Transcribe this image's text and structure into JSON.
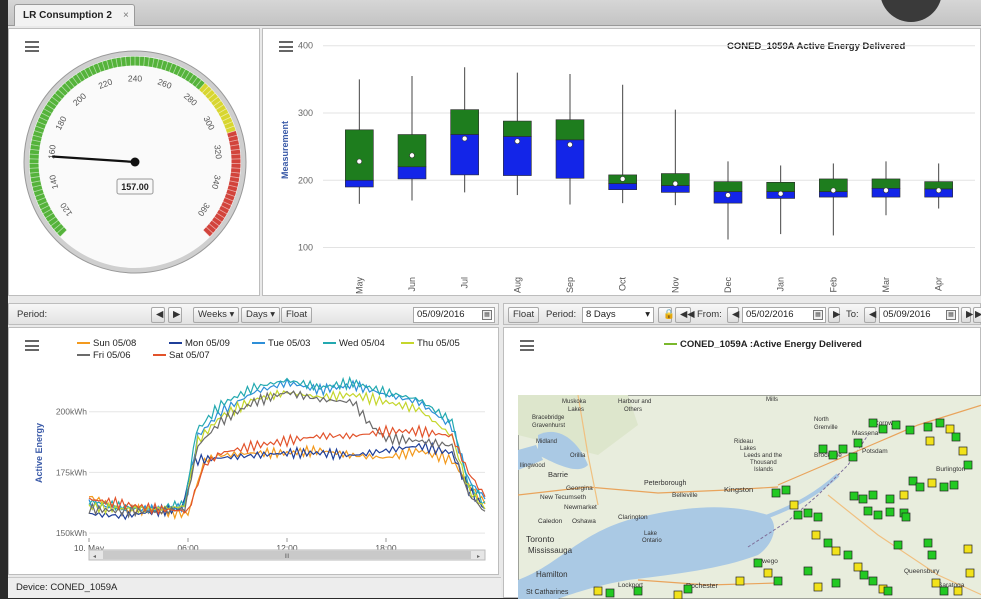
{
  "tab": {
    "label": "LR Consumption 2",
    "close": "×"
  },
  "gauge": {
    "value": 157.0,
    "value_label": "157.00",
    "ticks": [
      "120",
      "140",
      "160",
      "180",
      "200",
      "220",
      "240",
      "260",
      "280",
      "300",
      "320",
      "340",
      "360"
    ],
    "min": 110,
    "max": 370,
    "bands": [
      {
        "from": 110,
        "to": 280,
        "color": "#55b33b"
      },
      {
        "from": 280,
        "to": 310,
        "color": "#d8d630"
      },
      {
        "from": 310,
        "to": 370,
        "color": "#d2443c"
      }
    ]
  },
  "boxplot": {
    "title": "CONED_1059A Active Energy Delivered",
    "ylabel": "Measurement",
    "y_ticks": [
      "400",
      "300",
      "200",
      "100"
    ]
  },
  "line_toolbar": {
    "period_label": "Period:",
    "weeks": "Weeks ▾",
    "days": "Days ▾",
    "float": "Float",
    "date": "05/09/2016"
  },
  "line_chart": {
    "ylabel": "Active Energy",
    "y_ticks": [
      "200kWh",
      "175kWh",
      "150kWh"
    ],
    "x_ticks": [
      "10. May",
      "06:00",
      "12:00",
      "18:00"
    ],
    "scroll_grip": "III"
  },
  "map_toolbar": {
    "float": "Float",
    "period_label": "Period:",
    "period_value": "8 Days",
    "from_label": "From:",
    "from_value": "05/02/2016",
    "to_label": "To:",
    "to_value": "05/09/2016"
  },
  "map": {
    "legend": "CONED_1059A :Active Energy Delivered",
    "legend_color": "#7ab82c",
    "labels": {
      "muskoka": "Muskoka",
      "lakes": "Lakes",
      "bracebridge": "Bracebridge",
      "gravenhurst": "Gravenhurst",
      "harbour": "Harbour and",
      "others": "Others",
      "midland": "Midland",
      "orillia": "Orillia",
      "barrie": "Barrie",
      "georgina": "Georgina",
      "newtecumseth": "New Tecumseth",
      "newmarket": "Newmarket",
      "peterborough": "Peterborough",
      "belleville": "Belleville",
      "kingston": "Kingston",
      "clarington": "Clarington",
      "caledon": "Caledon",
      "oshawa": "Oshawa",
      "toronto": "Toronto",
      "mississauga": "Mississauga",
      "hamilton": "Hamilton",
      "stcatharines": "St Catharines",
      "lakeontario": "Lake",
      "lakeontario2": "Ontario",
      "lockport": "Lockport",
      "rochester": "Rochester",
      "rideau": "Rideau",
      "rideau2": "Lakes",
      "leeds": "Leeds and the",
      "thousand": "Thousand",
      "islands": "Islands",
      "brockville": "Brockville",
      "massena": "Massena",
      "potsdam": "Potsdam",
      "cornwall": "Cornwall",
      "burlington": "Burlington",
      "queensbury": "Queensbury",
      "saratoga": "Saratoga",
      "north": "North",
      "grenville": "Grenville",
      "mills": "Mills",
      "lingwood": "llingwood",
      "oswego": "Oswego"
    }
  },
  "status": {
    "text": "Device: CONED_1059A"
  },
  "chart_data": [
    {
      "type": "gauge",
      "value": 157.0,
      "min": 110,
      "max": 370
    },
    {
      "type": "boxplot",
      "title": "CONED_1059A Active Energy Delivered",
      "ylabel": "Measurement",
      "xlabel": "",
      "ylim": [
        80,
        410
      ],
      "categories": [
        "May",
        "Jun",
        "Jul",
        "Aug",
        "Sep",
        "Oct",
        "Nov",
        "Dec",
        "Jan",
        "Feb",
        "Mar",
        "Apr"
      ],
      "boxes": [
        {
          "min": 165,
          "q1": 190,
          "median": 200,
          "q3": 275,
          "max": 350,
          "mean": 228
        },
        {
          "min": 170,
          "q1": 202,
          "median": 220,
          "q3": 268,
          "max": 355,
          "mean": 237
        },
        {
          "min": 182,
          "q1": 208,
          "median": 268,
          "q3": 305,
          "max": 368,
          "mean": 262
        },
        {
          "min": 178,
          "q1": 207,
          "median": 265,
          "q3": 288,
          "max": 360,
          "mean": 258
        },
        {
          "min": 164,
          "q1": 203,
          "median": 260,
          "q3": 290,
          "max": 358,
          "mean": 253
        },
        {
          "min": 166,
          "q1": 186,
          "median": 195,
          "q3": 208,
          "max": 342,
          "mean": 202
        },
        {
          "min": 163,
          "q1": 182,
          "median": 192,
          "q3": 210,
          "max": 305,
          "mean": 195
        },
        {
          "min": 112,
          "q1": 166,
          "median": 183,
          "q3": 198,
          "max": 228,
          "mean": 178
        },
        {
          "min": 120,
          "q1": 173,
          "median": 183,
          "q3": 197,
          "max": 222,
          "mean": 180
        },
        {
          "min": 118,
          "q1": 175,
          "median": 183,
          "q3": 202,
          "max": 225,
          "mean": 185
        },
        {
          "min": 148,
          "q1": 175,
          "median": 188,
          "q3": 202,
          "max": 228,
          "mean": 185
        },
        {
          "min": 158,
          "q1": 175,
          "median": 187,
          "q3": 198,
          "max": 225,
          "mean": 185
        }
      ]
    },
    {
      "type": "line",
      "ylabel": "Active Energy",
      "x_ticks": [
        "10. May",
        "06:00",
        "12:00",
        "18:00"
      ],
      "ylim": [
        148,
        218
      ],
      "x_range_hours": [
        0,
        24
      ],
      "series": [
        {
          "name": "Sun 05/08",
          "color": "#f39a1e",
          "points": [
            [
              0,
              165
            ],
            [
              2,
              160
            ],
            [
              4,
              159
            ],
            [
              6,
              158
            ],
            [
              7,
              180
            ],
            [
              8,
              182
            ],
            [
              10,
              183
            ],
            [
              12,
              183
            ],
            [
              14,
              184
            ],
            [
              16,
              182
            ],
            [
              18,
              181
            ],
            [
              20,
              184
            ],
            [
              22,
              180
            ],
            [
              23,
              170
            ],
            [
              24,
              162
            ]
          ]
        },
        {
          "name": "Mon 05/09",
          "color": "#1f3f99",
          "points": [
            [
              0,
              158
            ],
            [
              2,
              157
            ],
            [
              4,
              159
            ],
            [
              5.6,
              160
            ],
            [
              6.4,
              180
            ],
            [
              8,
              181
            ],
            [
              10,
              182
            ],
            [
              12,
              183
            ],
            [
              14,
              183
            ],
            [
              16,
              182
            ],
            [
              18,
              184
            ],
            [
              20,
              186
            ],
            [
              22,
              183
            ],
            [
              23,
              168
            ],
            [
              24,
              160
            ]
          ]
        },
        {
          "name": "Tue 05/03",
          "color": "#2e8fd8",
          "points": [
            [
              0,
              162
            ],
            [
              2,
              160
            ],
            [
              4,
              160
            ],
            [
              5.8,
              161
            ],
            [
              6.6,
              190
            ],
            [
              8,
              200
            ],
            [
              10,
              208
            ],
            [
              12,
              212
            ],
            [
              14,
              209
            ],
            [
              16,
              211
            ],
            [
              18,
              207
            ],
            [
              20,
              204
            ],
            [
              22,
              194
            ],
            [
              23,
              172
            ],
            [
              24,
              164
            ]
          ]
        },
        {
          "name": "Wed 05/04",
          "color": "#23a9b0",
          "points": [
            [
              0,
              163
            ],
            [
              2,
              161
            ],
            [
              4,
              160
            ],
            [
              5.8,
              162
            ],
            [
              6.5,
              192
            ],
            [
              8,
              203
            ],
            [
              10,
              210
            ],
            [
              12,
              213
            ],
            [
              14,
              210
            ],
            [
              16,
              212
            ],
            [
              18,
              208
            ],
            [
              20,
              205
            ],
            [
              22,
              196
            ],
            [
              23,
              170
            ],
            [
              24,
              163
            ]
          ]
        },
        {
          "name": "Thu 05/05",
          "color": "#c5d62c",
          "points": [
            [
              0,
              161
            ],
            [
              2,
              160
            ],
            [
              4,
              160
            ],
            [
              5.8,
              161
            ],
            [
              6.6,
              188
            ],
            [
              8,
              198
            ],
            [
              10,
              205
            ],
            [
              12,
              208
            ],
            [
              14,
              206
            ],
            [
              16,
              207
            ],
            [
              18,
              204
            ],
            [
              20,
              201
            ],
            [
              22,
              190
            ],
            [
              23,
              168
            ],
            [
              24,
              160
            ]
          ]
        },
        {
          "name": "Fri 05/06",
          "color": "#6b6b6b",
          "points": [
            [
              0,
              160
            ],
            [
              2,
              159
            ],
            [
              4,
              159
            ],
            [
              5.8,
              160
            ],
            [
              6.6,
              186
            ],
            [
              8,
              196
            ],
            [
              10,
              204
            ],
            [
              12,
              208
            ],
            [
              14,
              205
            ],
            [
              16,
              204
            ],
            [
              17,
              195
            ],
            [
              18,
              189
            ],
            [
              20,
              188
            ],
            [
              22,
              186
            ],
            [
              23,
              166
            ],
            [
              24,
              159
            ]
          ]
        },
        {
          "name": "Sat 05/07",
          "color": "#e2532b",
          "points": [
            [
              0,
              164
            ],
            [
              2,
              162
            ],
            [
              4,
              160
            ],
            [
              6,
              159
            ],
            [
              7,
              178
            ],
            [
              8,
              183
            ],
            [
              10,
              186
            ],
            [
              12,
              188
            ],
            [
              14,
              190
            ],
            [
              16,
              190
            ],
            [
              18,
              192
            ],
            [
              20,
              192
            ],
            [
              22,
              190
            ],
            [
              23,
              175
            ],
            [
              24,
              165
            ]
          ]
        }
      ]
    }
  ]
}
